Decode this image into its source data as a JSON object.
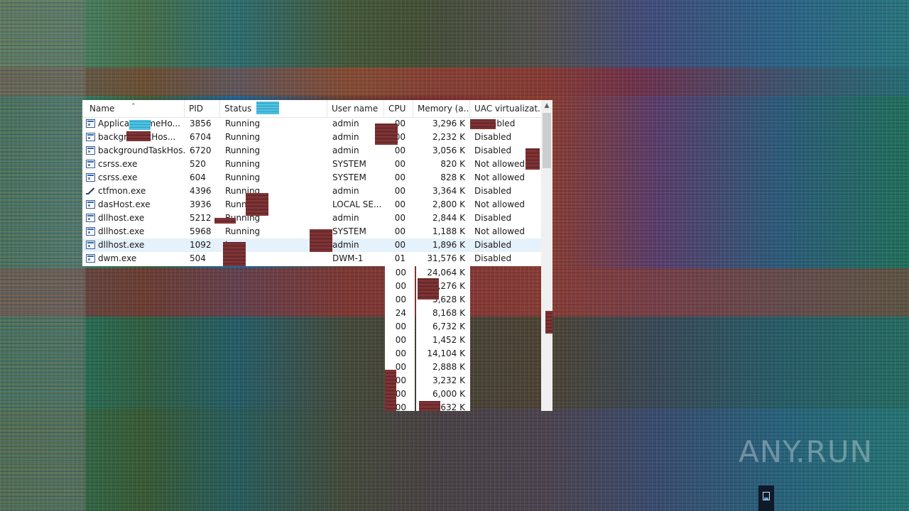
{
  "columns": [
    "Name",
    "PID",
    "Status",
    "User name",
    "CPU",
    "Memory (a...",
    "UAC virtualizat..."
  ],
  "processes": [
    {
      "name": "Applicat",
      "name_tail": "ameHo...",
      "pid": "3856",
      "status": "Running",
      "user": "admin",
      "cpu": "00",
      "memory": "3,296 K",
      "uac": "abled",
      "icon": "app-window-icon"
    },
    {
      "name": "backgro",
      "name_tail": "skHos...",
      "pid": "6704",
      "status": "Running",
      "user": "admin",
      "cpu": "00",
      "memory": "2,232 K",
      "uac": "Disabled",
      "icon": "app-window-icon"
    },
    {
      "name": "backgroundTaskHos...",
      "name_tail": "",
      "pid": "6720",
      "status": "Running",
      "user": "admin",
      "cpu": "00",
      "memory": "3,056 K",
      "uac": "Disabled",
      "icon": "app-window-icon"
    },
    {
      "name": "csrss.exe",
      "name_tail": "",
      "pid": "520",
      "status": "Running",
      "user": "SYSTEM",
      "cpu": "00",
      "memory": "820 K",
      "uac": "Not allowed",
      "icon": "app-window-icon"
    },
    {
      "name": "csrss.exe",
      "name_tail": "",
      "pid": "604",
      "status": "Running",
      "user": "SYSTEM",
      "cpu": "00",
      "memory": "828 K",
      "uac": "Not allowed",
      "icon": "app-window-icon"
    },
    {
      "name": "ctfmon.exe",
      "name_tail": "",
      "pid": "4396",
      "status": "Running",
      "user": "admin",
      "cpu": "00",
      "memory": "3,364 K",
      "uac": "Disabled",
      "icon": "pen-icon"
    },
    {
      "name": "dasHost.exe",
      "name_tail": "",
      "pid": "3936",
      "status": "Runni",
      "user": "LOCAL SE...",
      "cpu": "00",
      "memory": "2,800 K",
      "uac": "Not allowed",
      "icon": "app-window-icon"
    },
    {
      "name": "dllhost.exe",
      "name_tail": "",
      "pid": "5212",
      "status": "Running",
      "user": "admin",
      "cpu": "00",
      "memory": "2,844 K",
      "uac": "Disabled",
      "icon": "app-window-icon"
    },
    {
      "name": "dllhost.exe",
      "name_tail": "",
      "pid": "5968",
      "status": "Running",
      "user": "SYSTEM",
      "cpu": "00",
      "memory": "1,188 K",
      "uac": "Not allowed",
      "icon": "app-window-icon"
    },
    {
      "name": "dllhost.exe",
      "name_tail": "",
      "pid": "1092",
      "status": "ing",
      "user": "admin",
      "cpu": "00",
      "memory": "1,896 K",
      "uac": "Disabled",
      "icon": "app-window-icon",
      "selected": true
    },
    {
      "name": "dwm.exe",
      "name_tail": "",
      "pid": "504",
      "status": "ing",
      "user": "DWM-1",
      "cpu": "01",
      "memory": "31,576 K",
      "uac": "Disabled",
      "icon": "app-window-icon"
    }
  ],
  "overflow_rows": [
    {
      "cpu": "00",
      "memory": "24,064 K"
    },
    {
      "cpu": "00",
      "memory": "1,276 K"
    },
    {
      "cpu": "00",
      "memory": "5,628 K"
    },
    {
      "cpu": "24",
      "memory": "8,168 K"
    },
    {
      "cpu": "00",
      "memory": "6,732 K"
    },
    {
      "cpu": "00",
      "memory": "1,452 K"
    },
    {
      "cpu": "00",
      "memory": "14,104 K"
    },
    {
      "cpu": "00",
      "memory": "2,888 K"
    },
    {
      "cpu": "00",
      "memory": "3,232 K"
    },
    {
      "cpu": "00",
      "memory": "6,000 K"
    },
    {
      "cpu": "00",
      "memory": ",632 K"
    }
  ],
  "watermark": "ANY.RUN",
  "colors": {
    "selected_row": "#e5f1fb",
    "header_border": "#e5e5e5",
    "glitch_red": "#7a2e2e"
  }
}
